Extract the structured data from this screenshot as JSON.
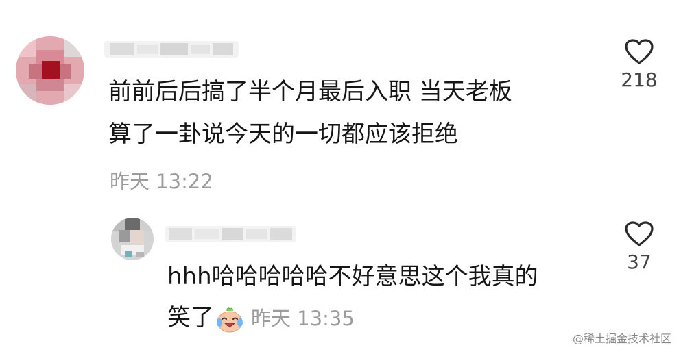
{
  "comment": {
    "text_line1": "前前后后搞了半个月最后入职 当天老板",
    "text_line2": "算了一卦说今天的一切都应该拒绝",
    "time": "昨天 13:22",
    "like_count": "218",
    "like_icon": "heart-outline-icon"
  },
  "reply": {
    "text_line1": "hhh哈哈哈哈哈不好意思这个我真的",
    "text_line2": "笑了",
    "emoji": "laughing-crying-emoji-icon",
    "time": "昨天 13:35",
    "like_count": "37",
    "like_icon": "heart-outline-icon"
  },
  "watermark": "@稀土掘金技术社区"
}
